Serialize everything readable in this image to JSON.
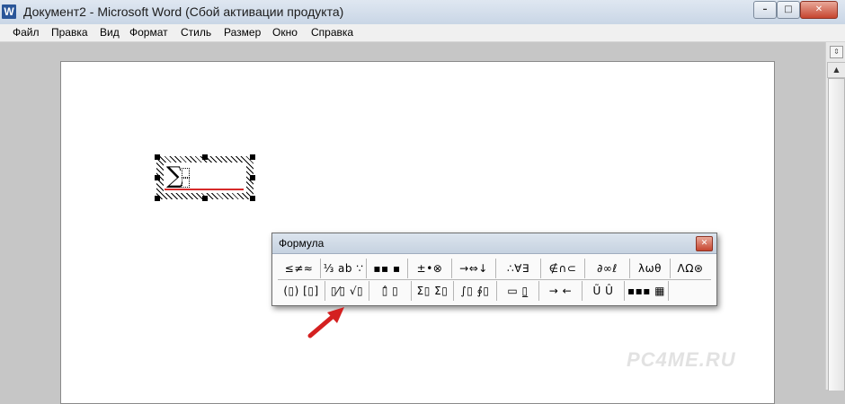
{
  "window": {
    "title": "Документ2 - Microsoft Word (Сбой активации продукта)",
    "app_icon": "W",
    "buttons": [
      "minimize-icon",
      "maximize-icon",
      "close-icon"
    ]
  },
  "menu": [
    "Файл",
    "Правка",
    "Вид",
    "Формат",
    "Стиль",
    "Размер",
    "Окно",
    "Справка"
  ],
  "palette": {
    "title": "Формула",
    "row1": [
      "≤≠≈",
      "⅓ ab ∵",
      "▪▪ ▪",
      "±•⊗",
      "→⇔↓",
      "∴∀∃",
      "∉∩⊂",
      "∂∞ℓ",
      "λωθ",
      "ΛΩ⊛"
    ],
    "row2": [
      "(▯) [▯]",
      "▯⁄▯ √▯",
      "▯̂ ▯",
      "Σ▯ Σ▯",
      "∫▯ ∮▯",
      "▭ ▯̲",
      "→ ←",
      "Ũ Û",
      "▪▪▪ ▦"
    ]
  },
  "watermark": "PC4ME.RU",
  "colors": {
    "arrow": "#d42020",
    "underline": "#d62a2a"
  }
}
